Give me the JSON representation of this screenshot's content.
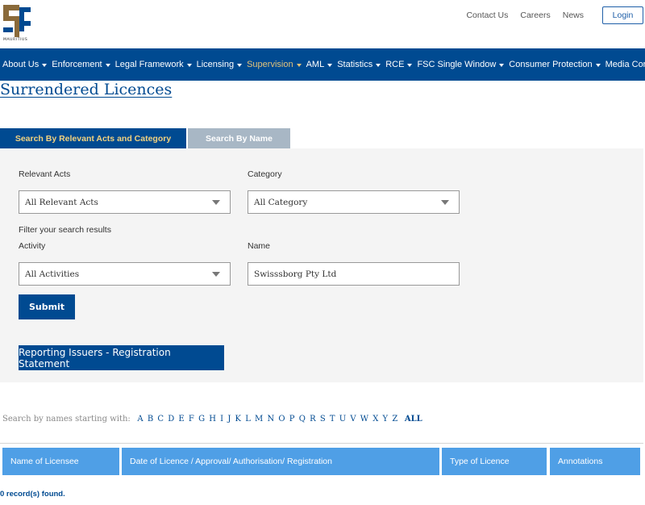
{
  "header": {
    "logo_text": "MAURITIUS",
    "links": [
      "Contact Us",
      "Careers",
      "News"
    ],
    "login_label": "Login"
  },
  "nav": {
    "items": [
      {
        "label": "About Us",
        "active": false
      },
      {
        "label": "Enforcement",
        "active": false
      },
      {
        "label": "Legal Framework",
        "active": false
      },
      {
        "label": "Licensing",
        "active": false
      },
      {
        "label": "Supervision",
        "active": true
      },
      {
        "label": "AML",
        "active": false
      },
      {
        "label": "Statistics",
        "active": false
      },
      {
        "label": "RCE",
        "active": false
      },
      {
        "label": "FSC Single Window",
        "active": false
      },
      {
        "label": "Consumer Protection",
        "active": false
      },
      {
        "label": "Media Corner",
        "active": false
      }
    ],
    "active_color": "#e2c37a",
    "bar_color": "#004a91"
  },
  "page_title": "Surrendered Licences",
  "tabs": [
    {
      "label": "Search By Relevant Acts and Category",
      "active": true
    },
    {
      "label": "Search By Name",
      "active": false
    }
  ],
  "search": {
    "relevant_acts_label": "Relevant Acts",
    "relevant_acts_value": "All Relevant Acts",
    "category_label": "Category",
    "category_value": "All Category",
    "filter_hint": "Filter your search results",
    "activity_label": "Activity",
    "activity_value": "All Activities",
    "name_label": "Name",
    "name_value": "Swisssborg Pty Ltd",
    "submit_label": "Submit",
    "reporting_button_label": "Reporting Issuers - Registration Statement"
  },
  "alphabet": {
    "label": "Search by names starting with:",
    "letters": [
      "A",
      "B",
      "C",
      "D",
      "E",
      "F",
      "G",
      "H",
      "I",
      "J",
      "K",
      "L",
      "M",
      "N",
      "O",
      "P",
      "Q",
      "R",
      "S",
      "T",
      "U",
      "V",
      "W",
      "X",
      "Y",
      "Z"
    ],
    "all_label": "ALL"
  },
  "table": {
    "columns": [
      "Name of Licensee",
      "Date of Licence / Approval/ Authorisation/ Registration",
      "Type of Licence",
      "Annotations"
    ],
    "header_color": "#4f9fe6"
  },
  "records_text": "0 record(s) found."
}
